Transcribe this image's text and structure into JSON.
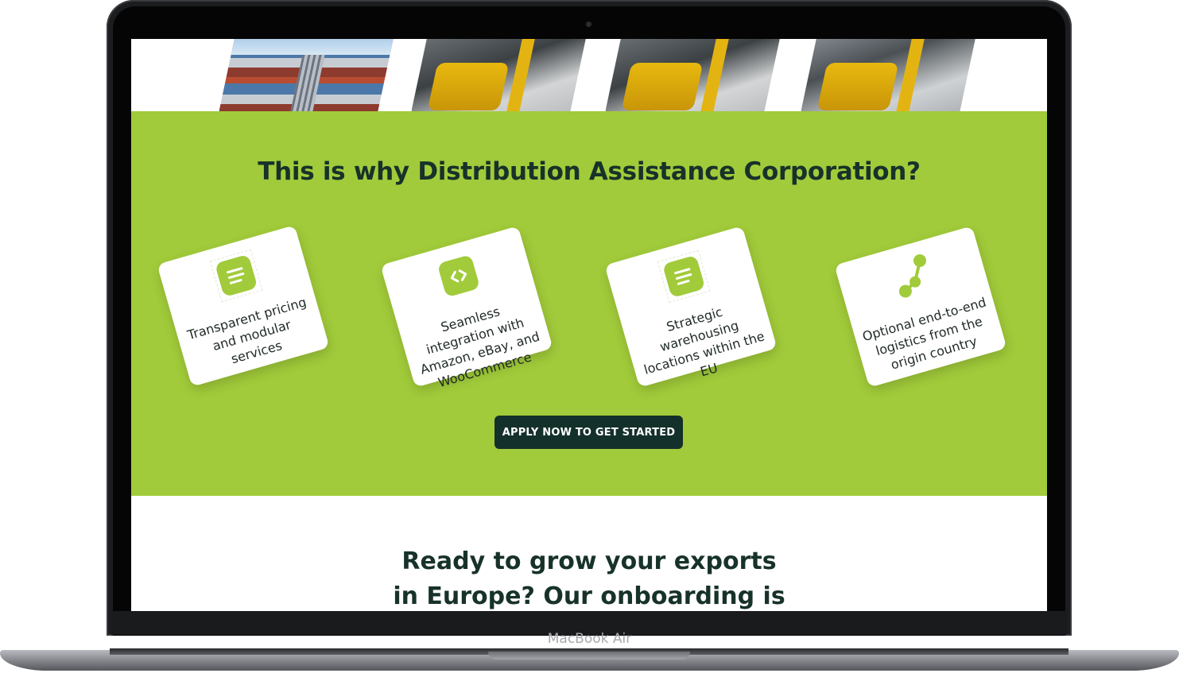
{
  "device": {
    "label": "MacBook Air"
  },
  "photo_strip": {
    "images": [
      "shipping-containers-photo",
      "forklift-photo",
      "forklift-photo",
      "forklift-worker-photo"
    ]
  },
  "why_section": {
    "title": "This is why Distribution Assistance Corporation?",
    "background": "#a1cb3a",
    "features": [
      {
        "icon": "list-icon",
        "label": "Transparent pricing and modular services"
      },
      {
        "icon": "code-brackets-icon",
        "label": "Seamless integration with Amazon, eBay, and WooCommerce"
      },
      {
        "icon": "list-icon",
        "label": "Strategic warehousing locations within the EU"
      },
      {
        "icon": "route-nodes-icon",
        "label": "Optional end-to-end logistics from the origin country"
      }
    ],
    "cta_label": "APPLY NOW TO GET STARTED"
  },
  "next_section": {
    "heading_line1": "Ready to grow your exports",
    "heading_line2": "in Europe? Our onboarding is"
  },
  "colors": {
    "accent": "#a1cb3a",
    "dark": "#14302a"
  }
}
